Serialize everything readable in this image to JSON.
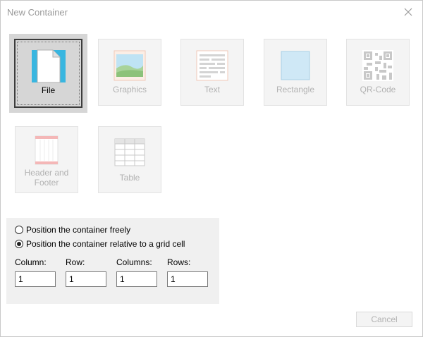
{
  "dialog": {
    "title": "New Container",
    "close_icon": "close-icon"
  },
  "tiles": [
    {
      "label": "File",
      "icon": "file-icon",
      "selected": true,
      "enabled": true
    },
    {
      "label": "Graphics",
      "icon": "graphics-icon",
      "selected": false,
      "enabled": false
    },
    {
      "label": "Text",
      "icon": "text-icon",
      "selected": false,
      "enabled": false
    },
    {
      "label": "Rectangle",
      "icon": "rectangle-icon",
      "selected": false,
      "enabled": false
    },
    {
      "label": "QR-Code",
      "icon": "qr-code-icon",
      "selected": false,
      "enabled": false
    },
    {
      "label_line1": "Header and",
      "label_line2": "Footer",
      "icon": "header-footer-icon",
      "selected": false,
      "enabled": false
    },
    {
      "label": "Table",
      "icon": "table-icon",
      "selected": false,
      "enabled": false
    }
  ],
  "position": {
    "option_free": "Position the container freely",
    "option_grid": "Position the container relative to a grid cell",
    "selected": "grid",
    "fields": [
      {
        "label": "Column:",
        "value": "1"
      },
      {
        "label": "Row:",
        "value": "1"
      },
      {
        "label": "Columns:",
        "value": "1"
      },
      {
        "label": "Rows:",
        "value": "1"
      }
    ]
  },
  "buttons": {
    "cancel": "Cancel"
  },
  "colors": {
    "selected_tile_bg": "#d6d6d6",
    "tile_bg": "#f4f4f4",
    "group_bg": "#f0f0f0",
    "disabled_text": "#b2b2b2"
  }
}
